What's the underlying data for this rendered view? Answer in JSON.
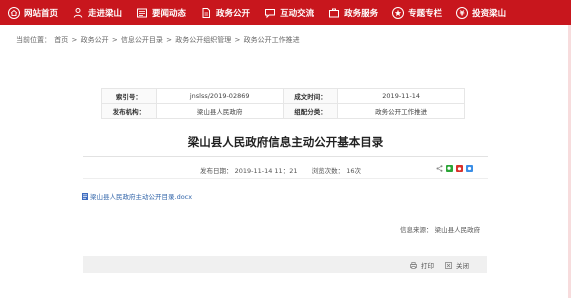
{
  "nav": {
    "items": [
      {
        "label": "网站首页",
        "icon": "home-icon"
      },
      {
        "label": "走进梁山",
        "icon": "person-icon"
      },
      {
        "label": "要闻动态",
        "icon": "news-icon"
      },
      {
        "label": "政务公开",
        "icon": "document-icon"
      },
      {
        "label": "互动交流",
        "icon": "chat-icon"
      },
      {
        "label": "政务服务",
        "icon": "service-icon"
      },
      {
        "label": "专题专栏",
        "icon": "topic-icon"
      },
      {
        "label": "投资梁山",
        "icon": "invest-icon"
      }
    ],
    "colors": {
      "bar": "#c8161d",
      "text": "#ffffff"
    }
  },
  "breadcrumb": {
    "prefix": "当前位置：",
    "items": [
      "首页",
      "政务公开",
      "信息公开目录",
      "政务公开组织管理",
      "政务公开工作推进"
    ],
    "separator": ">"
  },
  "meta": {
    "index_no_label": "索引号：",
    "index_no": "jnslss/2019-02869",
    "date_label": "成文时间：",
    "date": "2019-11-14",
    "publisher_label": "发布机构：",
    "publisher": "梁山县人民政府",
    "category_label": "组配分类：",
    "category": "政务公开工作推进"
  },
  "article": {
    "title": "梁山县人民政府信息主动公开基本目录",
    "publish_label": "发布日期：",
    "publish_time": "2019-11-14 11：21",
    "views_label": "浏览次数：",
    "views": "16次",
    "attachment": "梁山县人民政府主动公开目录.docx",
    "source_label": "信息来源：",
    "source": "梁山县人民政府"
  },
  "actions": {
    "print": "打印",
    "close": "关闭"
  }
}
